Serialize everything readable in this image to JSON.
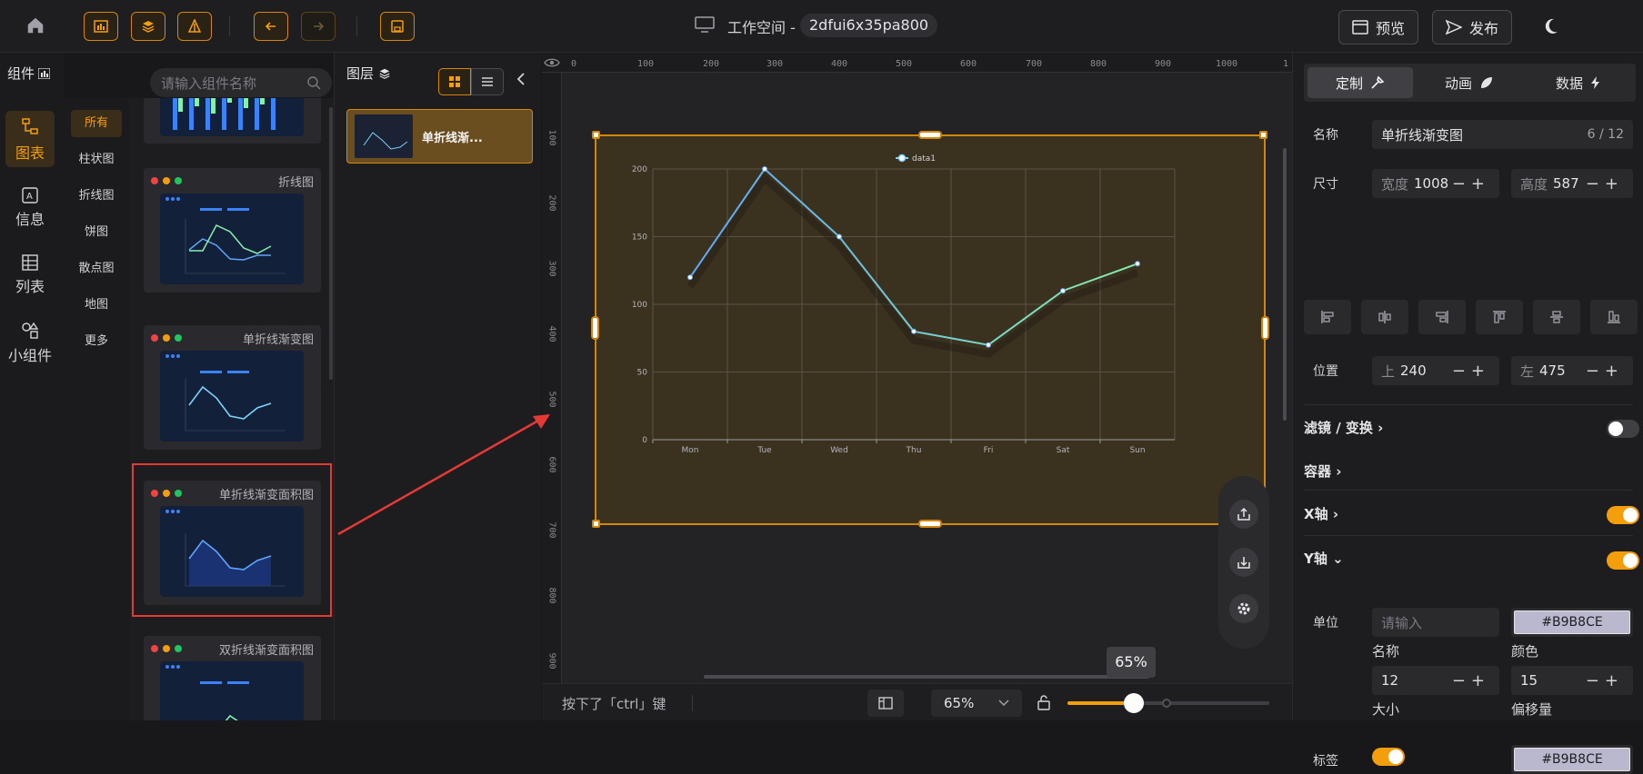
{
  "workspace": {
    "label": "工作空间 -",
    "id": "2dfui6x35pa800"
  },
  "header": {
    "preview": "预览",
    "publish": "发布"
  },
  "left_nav": {
    "title": "组件",
    "search_placeholder": "请输入组件名称",
    "items": [
      {
        "label": "图表",
        "active": true
      },
      {
        "label": "信息"
      },
      {
        "label": "列表"
      },
      {
        "label": "小组件"
      }
    ]
  },
  "categories": [
    "所有",
    "柱状图",
    "折线图",
    "饼图",
    "散点图",
    "地图",
    "更多"
  ],
  "cards": [
    {
      "title": "折线图"
    },
    {
      "title": "单折线渐变图"
    },
    {
      "title": "单折线渐变面积图"
    },
    {
      "title": "双折线渐变面积图"
    }
  ],
  "layers": {
    "title": "图层",
    "item": "单折线渐..."
  },
  "canvas": {
    "zoom_tooltip": "65%",
    "status_text": "按下了「ctrl」键",
    "zoom_select": "65%",
    "zoom_level": 0.65,
    "ruler_h": [
      "0",
      "100",
      "200",
      "300",
      "400",
      "500",
      "600",
      "700",
      "800",
      "900",
      "1000",
      "1"
    ],
    "ruler_v": [
      "100",
      "200",
      "300",
      "400",
      "500",
      "600",
      "700",
      "800",
      "900"
    ]
  },
  "chart_data": {
    "type": "line",
    "categories": [
      "Mon",
      "Tue",
      "Wed",
      "Thu",
      "Fri",
      "Sat",
      "Sun"
    ],
    "series": [
      {
        "name": "data1",
        "values": [
          120,
          200,
          150,
          80,
          70,
          110,
          130
        ]
      }
    ],
    "ylim": [
      0,
      200
    ],
    "yticks": [
      "0",
      "50",
      "100",
      "150",
      "200"
    ],
    "legend": "top-center",
    "grid": true
  },
  "panel": {
    "tabs": [
      "定制",
      "动画",
      "数据"
    ],
    "name_label": "名称",
    "name_value": "单折线渐变图",
    "name_count": "6 / 12",
    "size_label": "尺寸",
    "width_label": "宽度",
    "width_value": "1008",
    "height_label": "高度",
    "height_value": "587",
    "pos_label": "位置",
    "top_label": "上",
    "top_value": "240",
    "left_label": "左",
    "left_value": "475",
    "filter": "滤镜 / 变换",
    "container": "容器",
    "xaxis": "X轴",
    "yaxis": "Y轴",
    "unit_label": "单位",
    "unit_placeholder": "请输入",
    "color_value": "#B9B8CE",
    "name_caption": "名称",
    "color_caption": "颜色",
    "size_value": "12",
    "offset_value": "15",
    "size_caption": "大小",
    "offset_caption": "偏移量",
    "tag_label": "标签",
    "tag_color": "#B9B8CE"
  }
}
